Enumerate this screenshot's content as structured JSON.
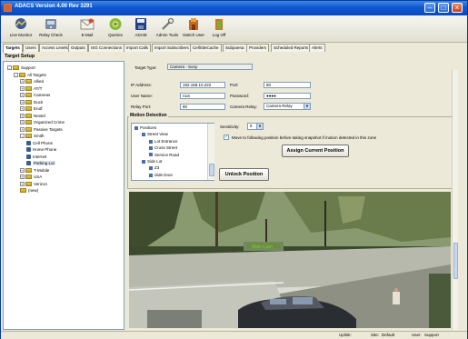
{
  "window": {
    "title": "ADACS Version 4.00 Rev 3291"
  },
  "toolbar": [
    {
      "label": "Live Monitor",
      "icon": "live-monitor-icon"
    },
    {
      "label": "Relay Check",
      "icon": "relay-check-icon"
    },
    {
      "label": "E-Mail",
      "icon": "email-icon"
    },
    {
      "label": "Queries",
      "icon": "queries-icon"
    },
    {
      "label": "ADAM",
      "icon": "adam-icon"
    },
    {
      "label": "Admin Tools",
      "icon": "admin-tools-icon"
    },
    {
      "label": "Switch User",
      "icon": "switch-user-icon"
    },
    {
      "label": "Log Off",
      "icon": "log-off-icon"
    }
  ],
  "tabs": [
    "Targets",
    "Users",
    "Access Levels",
    "Outputs",
    "ISG Connections",
    "Import Calls",
    "Import Subscribers",
    "CellSiteCache",
    "Subpoena",
    "Providers",
    "Scheduled Reports",
    "Alerts"
  ],
  "section": {
    "title": "Target Setup"
  },
  "tree": [
    {
      "label": "Support",
      "level": 0,
      "kind": "folder",
      "expand": "-"
    },
    {
      "label": "All Targets",
      "level": 1,
      "kind": "folder",
      "expand": "-"
    },
    {
      "label": "Allied",
      "level": 2,
      "kind": "folder",
      "expand": "+"
    },
    {
      "label": "AT/T",
      "level": 2,
      "kind": "folder",
      "expand": "+"
    },
    {
      "label": "Cameras",
      "level": 2,
      "kind": "folder",
      "expand": "+"
    },
    {
      "label": "Duck",
      "level": 2,
      "kind": "folder",
      "expand": "+"
    },
    {
      "label": "Erutf",
      "level": 2,
      "kind": "folder",
      "expand": "+"
    },
    {
      "label": "Nextel",
      "level": 2,
      "kind": "folder",
      "expand": "+"
    },
    {
      "label": "Organized Crime",
      "level": 2,
      "kind": "folder",
      "expand": "+"
    },
    {
      "label": "Passive Targets",
      "level": 2,
      "kind": "folder",
      "expand": "+"
    },
    {
      "label": "Smith",
      "level": 2,
      "kind": "folder",
      "expand": "-"
    },
    {
      "label": "Cell Phone",
      "level": 3,
      "kind": "device",
      "expand": ""
    },
    {
      "label": "Home Phone",
      "level": 3,
      "kind": "device",
      "expand": ""
    },
    {
      "label": "Internet",
      "level": 3,
      "kind": "device",
      "expand": ""
    },
    {
      "label": "Parking Lot",
      "level": 3,
      "kind": "device",
      "expand": "",
      "selected": true
    },
    {
      "label": "T-Mobile",
      "level": 2,
      "kind": "folder",
      "expand": "+"
    },
    {
      "label": "USA",
      "level": 2,
      "kind": "folder",
      "expand": "+"
    },
    {
      "label": "Verizon",
      "level": 2,
      "kind": "folder",
      "expand": "+"
    },
    {
      "label": "(new)",
      "level": 2,
      "kind": "folder",
      "expand": ""
    }
  ],
  "target": {
    "type_label": "Target Type:",
    "type_value": "Camera - Sony",
    "ip_label": "IP Address:",
    "ip_value": "192.168.10.222",
    "port_label": "Port:",
    "port_value": "80",
    "user_label": "User Name:",
    "user_value": "root",
    "password_label": "Password:",
    "password_value": "●●●●",
    "relay_label": "Relay Port:",
    "relay_value": "80",
    "relay_type_label": "Camera Relay:",
    "relay_type_value": "Camera Relay"
  },
  "motion": {
    "title": "Motion Detection",
    "sensitivity_label": "Sensitivity:",
    "sensitivity_value": "5",
    "checkbox_label": "Move to following position before taking snapshot if motion detected in this zone",
    "checkbox_checked": true,
    "assign_button": "Assign Current Position",
    "unlock_button": "Unlock Position",
    "positions": [
      {
        "label": "Positions",
        "level": 0,
        "expand": "-"
      },
      {
        "label": "Street View",
        "level": 1,
        "expand": "-"
      },
      {
        "label": "Lot Entrance",
        "level": 2,
        "expand": ""
      },
      {
        "label": "Cross Street",
        "level": 2,
        "expand": ""
      },
      {
        "label": "Service Road",
        "level": 2,
        "expand": ""
      },
      {
        "label": "Side Lot",
        "level": 1,
        "expand": "-"
      },
      {
        "label": "Z3",
        "level": 2,
        "expand": ""
      },
      {
        "label": "Side Door",
        "level": 2,
        "expand": ""
      }
    ]
  },
  "statusbar": {
    "uplink": "Uplink:",
    "site_label": "Site:",
    "site_value": "Default",
    "user_label": "User:",
    "user_value": "Support"
  },
  "colors": {
    "title_bar": "#1058d0",
    "tree_folder": "#e2c244",
    "selection": "#dfe7f5"
  }
}
